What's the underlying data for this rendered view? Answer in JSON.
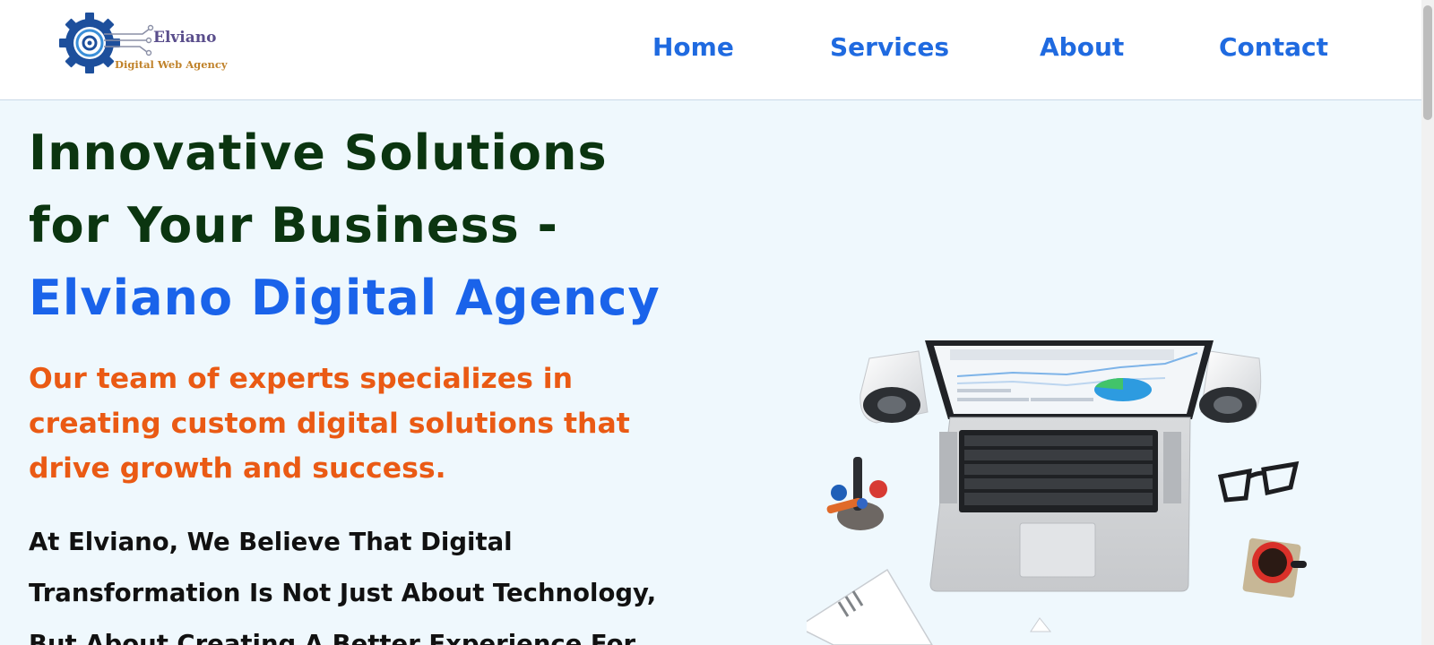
{
  "header": {
    "logo": {
      "name": "Elviano",
      "tagline": "Digital Web Agency"
    },
    "nav": [
      {
        "label": "Home"
      },
      {
        "label": "Services"
      },
      {
        "label": "About"
      },
      {
        "label": "Contact"
      }
    ]
  },
  "hero": {
    "title_main": "Innovative Solutions for Your Business - ",
    "title_accent": "Elviano Digital Agency",
    "subtitle": "Our team of experts specializes in creating custom digital solutions that drive growth and success.",
    "paragraph": "At Elviano, We Believe That Digital Transformation Is Not Just About Technology, But About Creating A Better Experience For"
  },
  "colors": {
    "nav_link": "#1f6ae0",
    "heading_dark": "#0b3510",
    "heading_accent": "#1a63ea",
    "subtitle": "#ea5a14",
    "page_background": "#eff8fd"
  },
  "icons": {
    "logo": "gear-circuit-logo-icon",
    "hero_image": "laptop-desk-illustration"
  }
}
